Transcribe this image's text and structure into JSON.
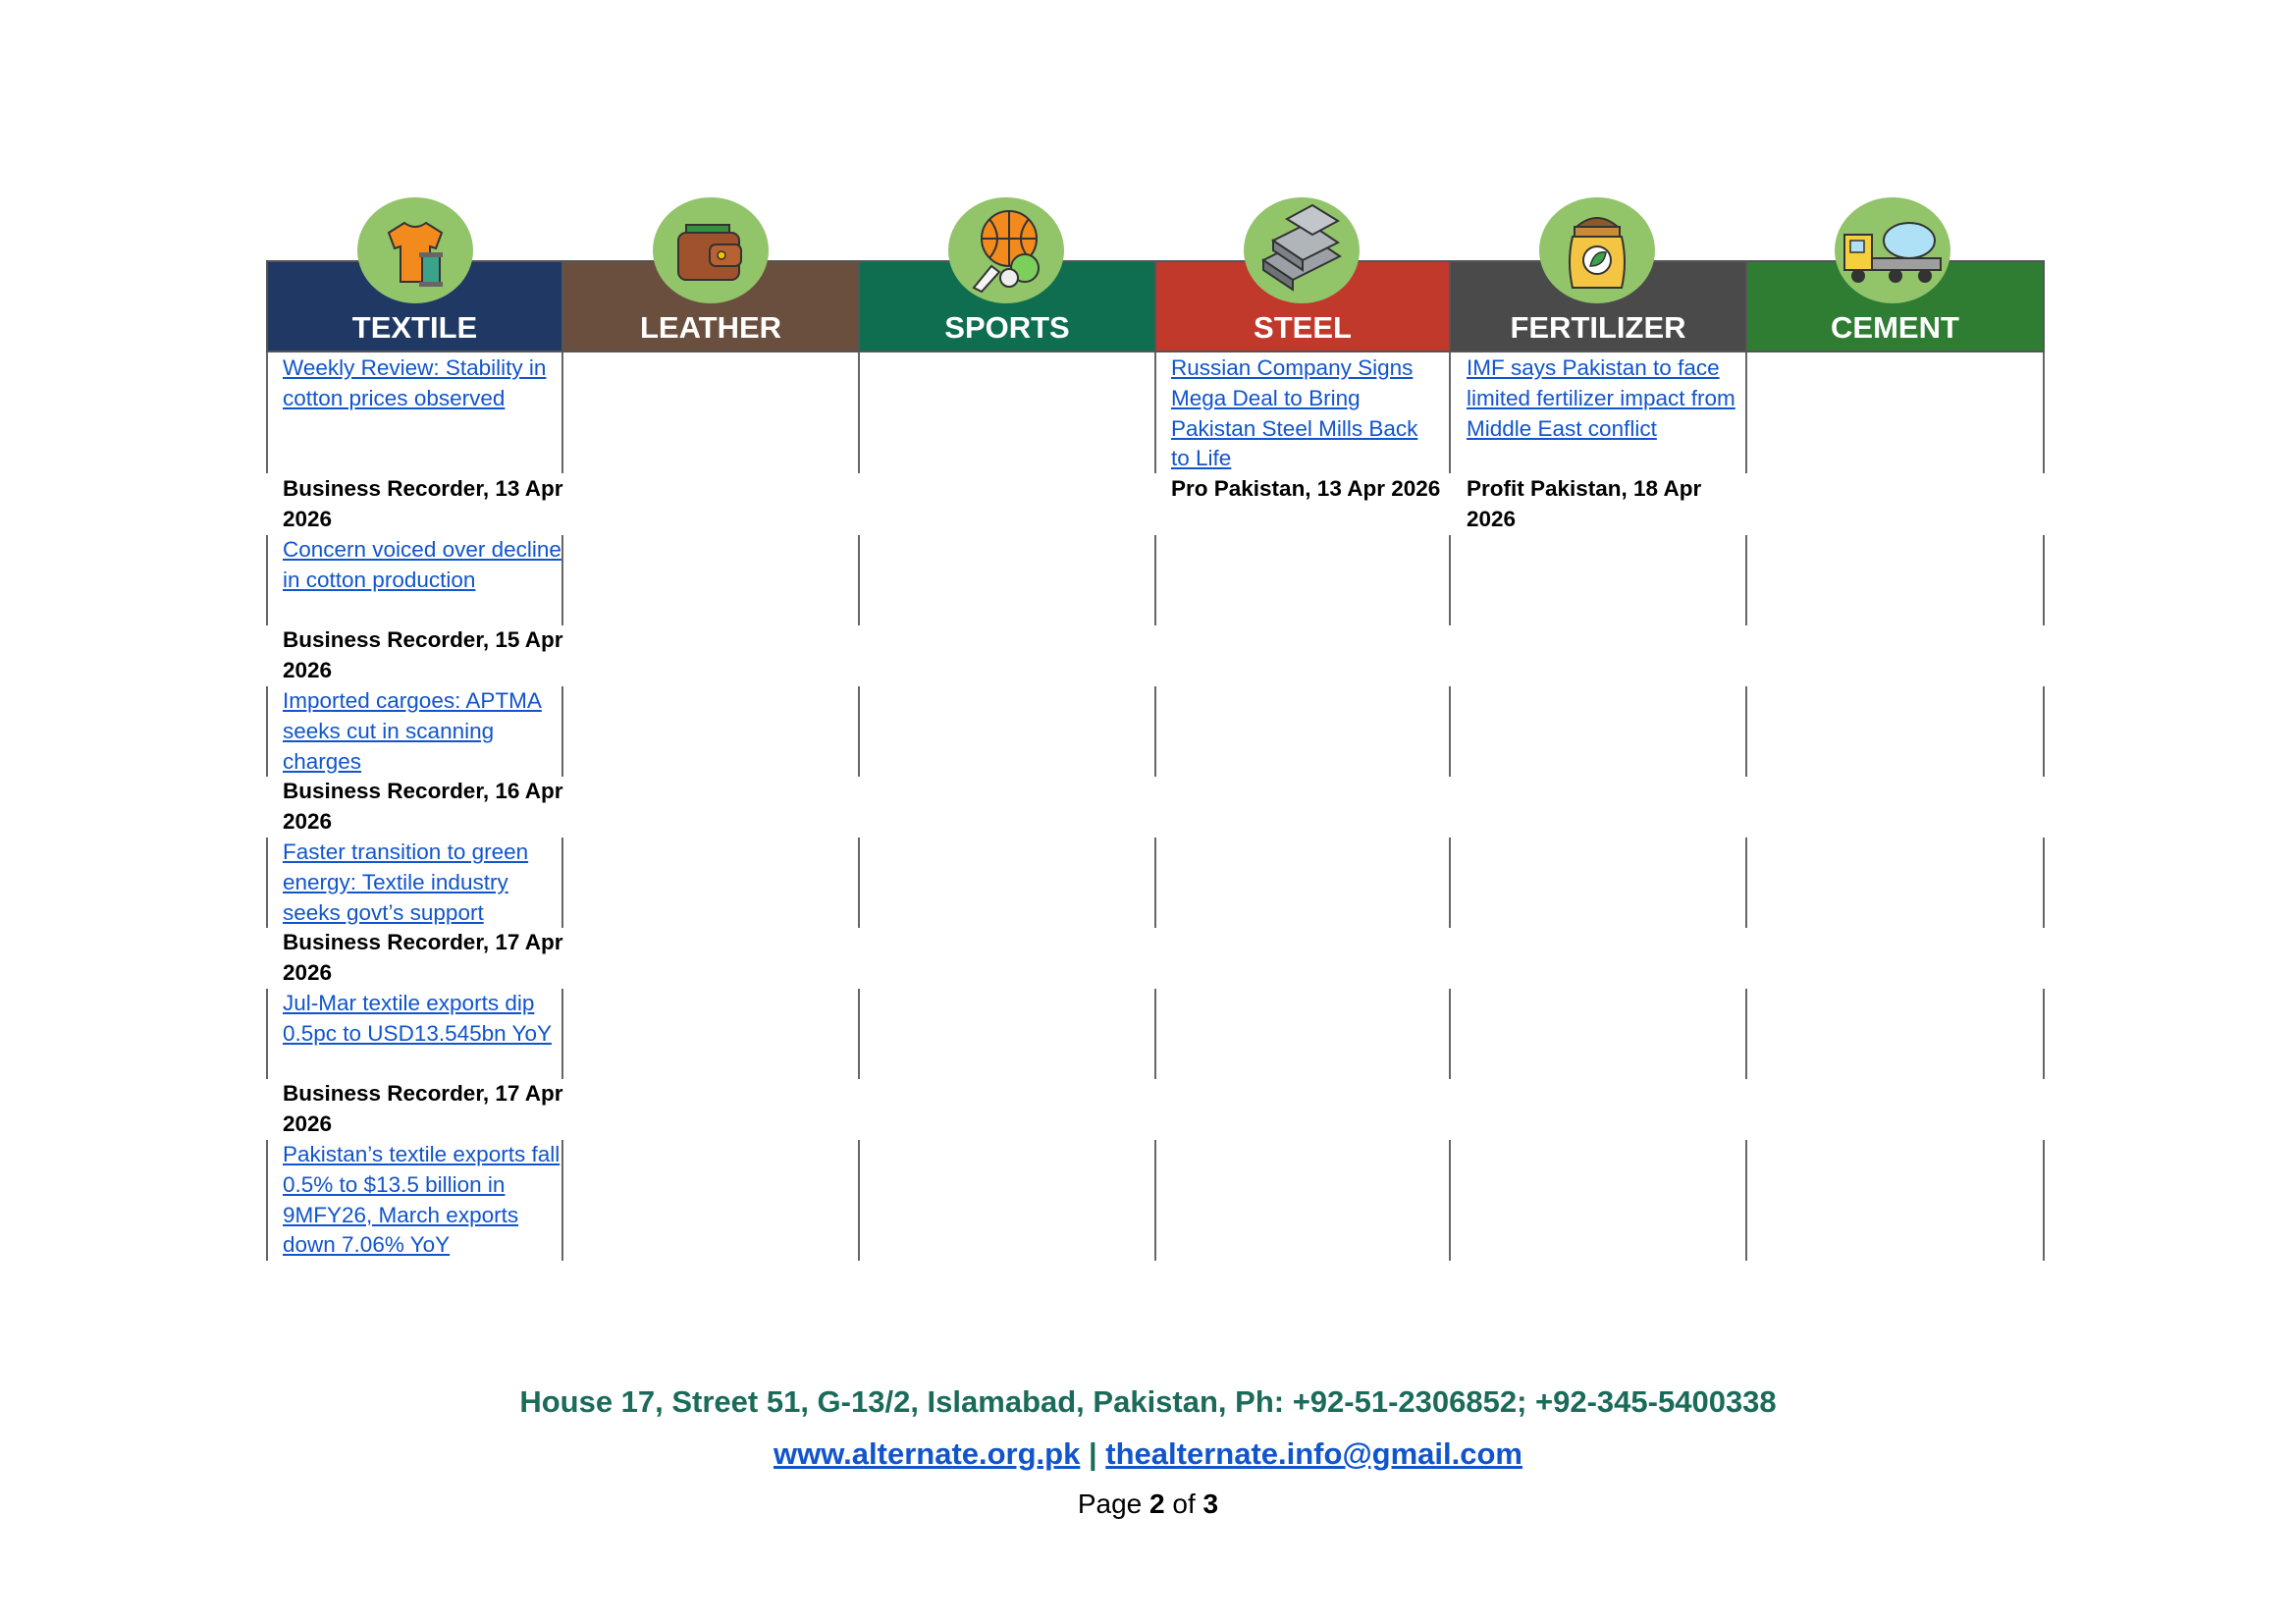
{
  "columns": [
    {
      "label": "TEXTILE",
      "color": "#1f3864",
      "icon": "tshirt-icon"
    },
    {
      "label": "LEATHER",
      "color": "#6b4f3e",
      "icon": "wallet-icon"
    },
    {
      "label": "SPORTS",
      "color": "#0e6e4f",
      "icon": "sports-balls-icon"
    },
    {
      "label": "STEEL",
      "color": "#c0392b",
      "icon": "steel-bars-icon"
    },
    {
      "label": "FERTILIZER",
      "color": "#4a4a4a",
      "icon": "fertilizer-bag-icon"
    },
    {
      "label": "CEMENT",
      "color": "#2e7d32",
      "icon": "cement-mixer-icon"
    }
  ],
  "textile": [
    {
      "title": "Weekly Review: Stability in cotton prices observed",
      "source": "Business Recorder, 13 Apr 2026"
    },
    {
      "title": "Concern voiced over decline in cotton production",
      "source": "Business Recorder, 15 Apr 2026"
    },
    {
      "title": "Imported cargoes: APTMA seeks cut in scanning charges",
      "source": "Business Recorder, 16 Apr 2026"
    },
    {
      "title": "Faster transition to green energy: Textile industry seeks govt’s support",
      "source": "Business Recorder, 17 Apr 2026"
    },
    {
      "title": "Jul-Mar textile exports dip 0.5pc to USD13.545bn YoY",
      "source": "Business Recorder, 17 Apr 2026"
    },
    {
      "title": "Pakistan’s textile exports fall 0.5% to $13.5 billion in 9MFY26, March exports down 7.06% YoY",
      "source": ""
    }
  ],
  "steel": [
    {
      "title": "Russian Company Signs Mega Deal to Bring Pakistan Steel Mills Back to Life",
      "source": "Pro Pakistan, 13 Apr 2026"
    }
  ],
  "fertilizer": [
    {
      "title": "IMF says Pakistan to face limited fertilizer impact from Middle East conflict",
      "source": "Profit Pakistan, 18 Apr 2026"
    }
  ],
  "footer": {
    "address": "House 17, Street 51, G-13/2, Islamabad, Pakistan, Ph: +92-51-2306852; +92-345-5400338",
    "website": "www.alternate.org.pk",
    "separator": "|",
    "email": "thealternate.info@gmail.com",
    "page_prefix": "Page",
    "page_current": "2",
    "page_mid": "of",
    "page_total": "3"
  }
}
